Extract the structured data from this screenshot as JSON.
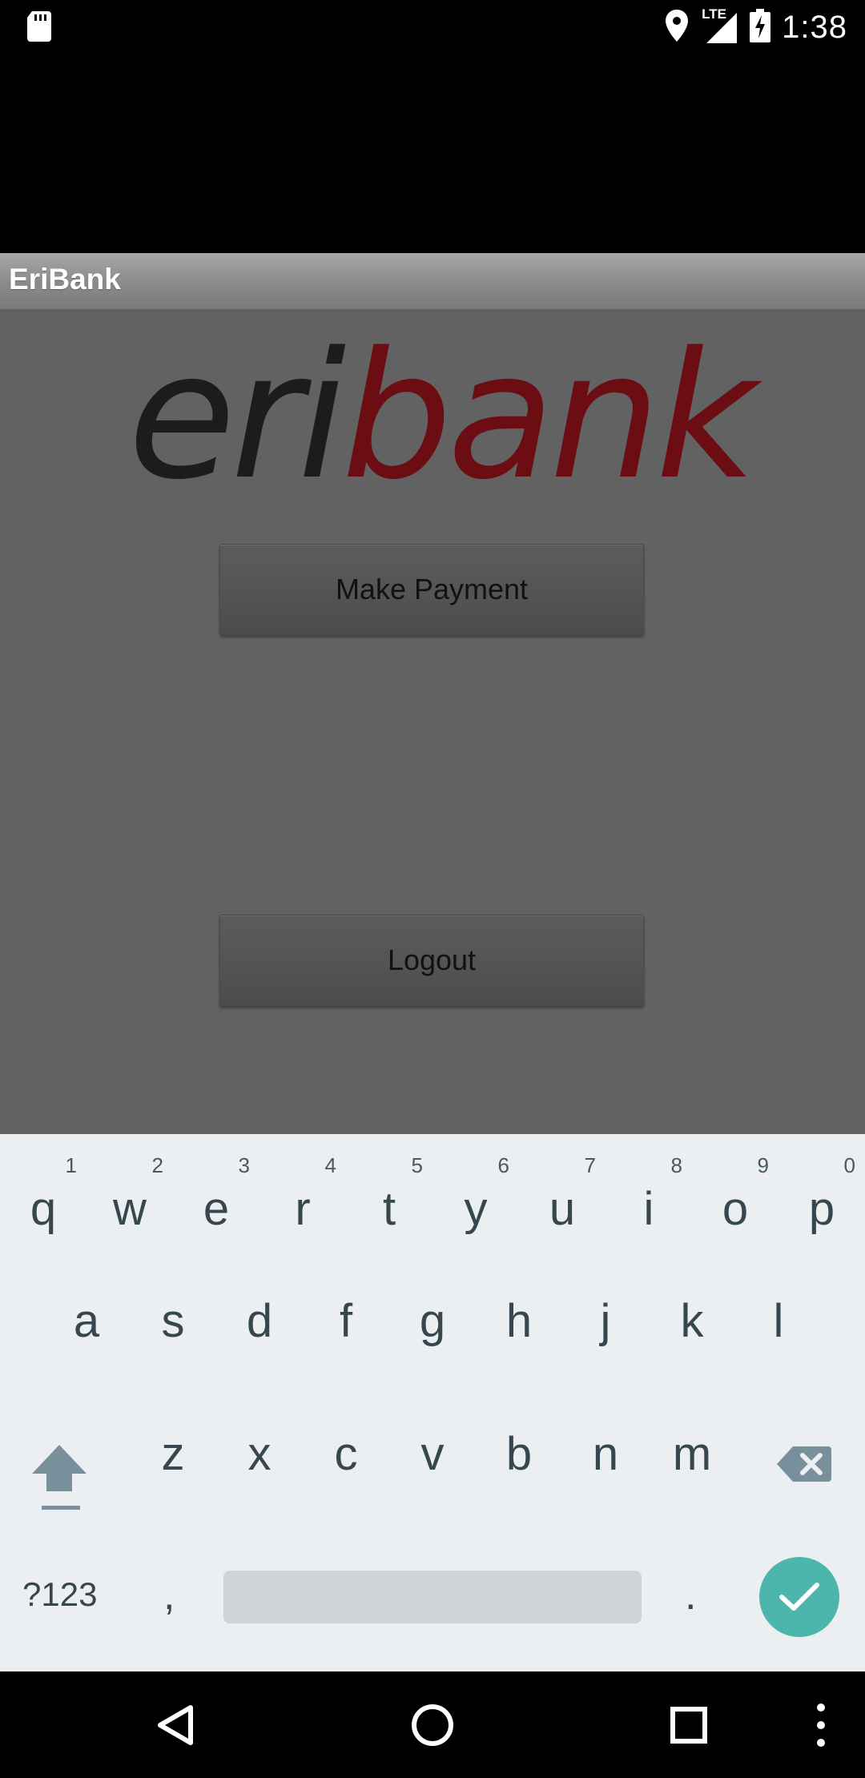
{
  "status_bar": {
    "time": "1:38",
    "network": "LTE",
    "icons": [
      "sd-card-icon",
      "location-icon",
      "signal-icon",
      "battery-charging-icon"
    ]
  },
  "app": {
    "title": "EriBank",
    "logo": {
      "part1": "eri",
      "part2": "bank"
    },
    "buttons": {
      "make_payment": "Make Payment",
      "logout": "Logout"
    },
    "colors": {
      "logo_dark": "#1c1c1c",
      "logo_red": "#6c0d14",
      "background": "#626262"
    }
  },
  "keyboard": {
    "row1": [
      {
        "key": "q",
        "hint": "1"
      },
      {
        "key": "w",
        "hint": "2"
      },
      {
        "key": "e",
        "hint": "3"
      },
      {
        "key": "r",
        "hint": "4"
      },
      {
        "key": "t",
        "hint": "5"
      },
      {
        "key": "y",
        "hint": "6"
      },
      {
        "key": "u",
        "hint": "7"
      },
      {
        "key": "i",
        "hint": "8"
      },
      {
        "key": "o",
        "hint": "9"
      },
      {
        "key": "p",
        "hint": "0"
      }
    ],
    "row2": [
      "a",
      "s",
      "d",
      "f",
      "g",
      "h",
      "j",
      "k",
      "l"
    ],
    "row3": [
      "z",
      "x",
      "c",
      "v",
      "b",
      "n",
      "m"
    ],
    "symbols_key": "?123",
    "comma": ",",
    "period": ".",
    "accent": "#4db6ac"
  },
  "nav_bar": {
    "icons": [
      "back-icon",
      "home-icon",
      "recents-icon",
      "menu-icon"
    ]
  }
}
